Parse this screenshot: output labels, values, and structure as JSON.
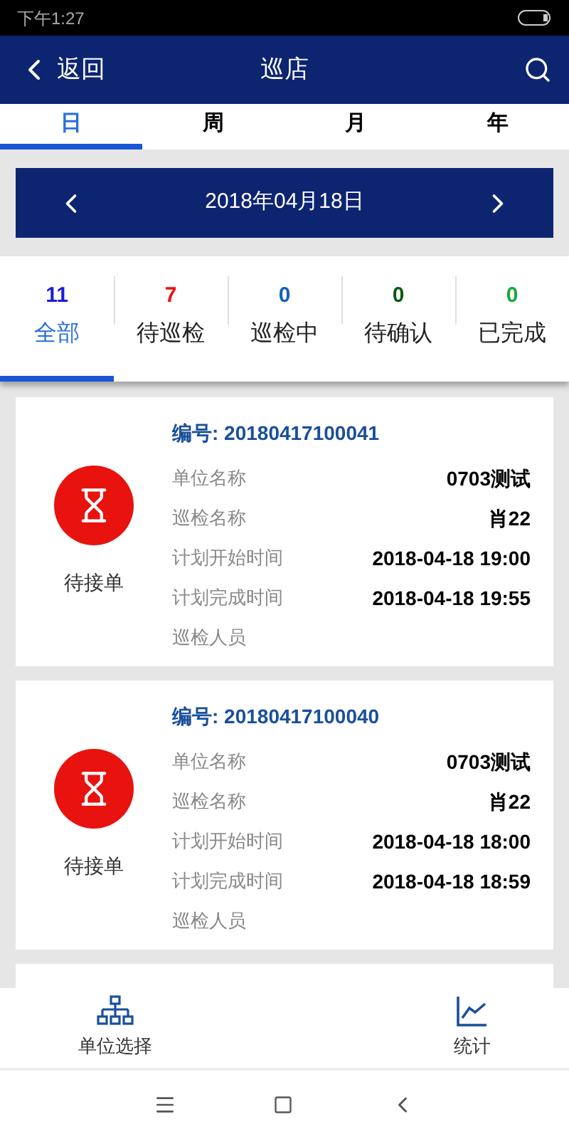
{
  "status_bar": {
    "time": "下午1:27"
  },
  "header": {
    "back": "返回",
    "title": "巡店"
  },
  "period_tabs": [
    {
      "label": "日",
      "selected": true
    },
    {
      "label": "周",
      "selected": false
    },
    {
      "label": "月",
      "selected": false
    },
    {
      "label": "年",
      "selected": false
    }
  ],
  "date_bar": {
    "date": "2018年04月18日"
  },
  "status_tabs": [
    {
      "count": "11",
      "label": "全部",
      "color": "#1a1adb",
      "selected": true
    },
    {
      "count": "7",
      "label": "待巡检",
      "color": "#f01010",
      "selected": false
    },
    {
      "count": "0",
      "label": "巡检中",
      "color": "#1560c0",
      "selected": false
    },
    {
      "count": "0",
      "label": "待确认",
      "color": "#0a5a12",
      "selected": false
    },
    {
      "count": "0",
      "label": "已完成",
      "color": "#18a83a",
      "selected": false
    }
  ],
  "orders": [
    {
      "number": "编号: 20180417100041",
      "status": "待接单",
      "fields": [
        {
          "label": "单位名称",
          "value": "0703测试"
        },
        {
          "label": "巡检名称",
          "value": "肖22"
        },
        {
          "label": "计划开始时间",
          "value": "2018-04-18 19:00"
        },
        {
          "label": "计划完成时间",
          "value": "2018-04-18 19:55"
        },
        {
          "label": "巡检人员"
        }
      ]
    },
    {
      "number": "编号: 20180417100040",
      "status": "待接单",
      "fields": [
        {
          "label": "单位名称",
          "value": "0703测试"
        },
        {
          "label": "巡检名称",
          "value": "肖22"
        },
        {
          "label": "计划开始时间",
          "value": "2018-04-18 18:00"
        },
        {
          "label": "计划完成时间",
          "value": "2018-04-18 18:59"
        },
        {
          "label": "巡检人员"
        }
      ]
    }
  ],
  "bottom_nav": [
    {
      "label": "单位选择",
      "kind": "org"
    },
    {
      "label": "统计",
      "kind": "chart"
    }
  ]
}
